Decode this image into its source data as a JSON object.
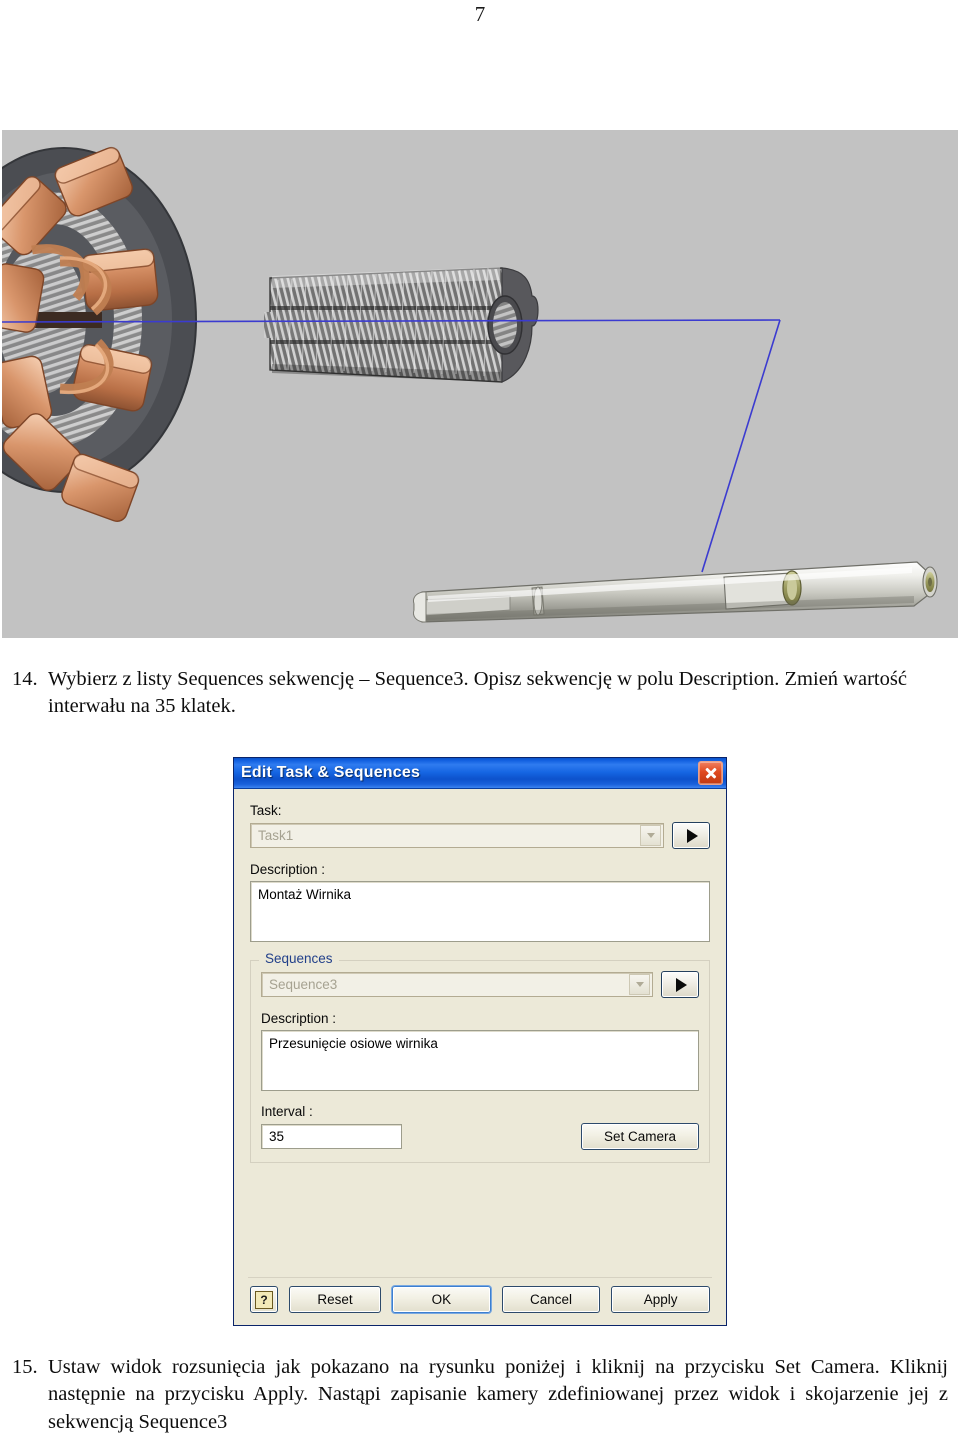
{
  "page": {
    "number": "7"
  },
  "figure": {
    "caption_alt": "Widok rozsunięcia wirnika silnika elektrycznego",
    "background_color": "#c2c2c2",
    "parts": {
      "stator_windings": "copper-windings",
      "rotor_core": "laminated-rotor-core",
      "shaft": "motor-shaft",
      "trail_line_color": "#3b3bd0"
    }
  },
  "instructions": [
    {
      "number": "14.",
      "text": "Wybierz z listy Sequences sekwencję – Sequence3. Opisz sekwencję w polu Description. Zmień wartość interwału na 35 klatek."
    },
    {
      "number": "15.",
      "text": "Ustaw widok rozsunięcia jak pokazano na rysunku poniżej i kliknij na przycisku Set Camera. Kliknij następnie na przycisku Apply. Nastąpi zapisanie kamery zdefiniowanej przez widok i skojarzenie jej z sekwencją Sequence3"
    }
  ],
  "dialog": {
    "title": "Edit Task & Sequences",
    "close_tooltip": "Close",
    "task": {
      "label": "Task:",
      "value": "Task1",
      "play_button_label": "▶"
    },
    "task_description": {
      "label": "Description :",
      "value": "Montaż Wirnika"
    },
    "sequences_group": {
      "legend": "Sequences",
      "sequence": {
        "value": "Sequence3",
        "play_button_label": "▶"
      },
      "description": {
        "label": "Description :",
        "value": "Przesunięcie osiowe wirnika"
      },
      "interval": {
        "label": "Interval :",
        "value": "35"
      },
      "set_camera_label": "Set Camera"
    },
    "buttons": {
      "help": "?",
      "reset": "Reset",
      "ok": "OK",
      "cancel": "Cancel",
      "apply": "Apply"
    },
    "colors": {
      "titlebar": "#1565e2",
      "face": "#ece9d8",
      "legend_text": "#22408a",
      "close": "#e04a20"
    }
  }
}
